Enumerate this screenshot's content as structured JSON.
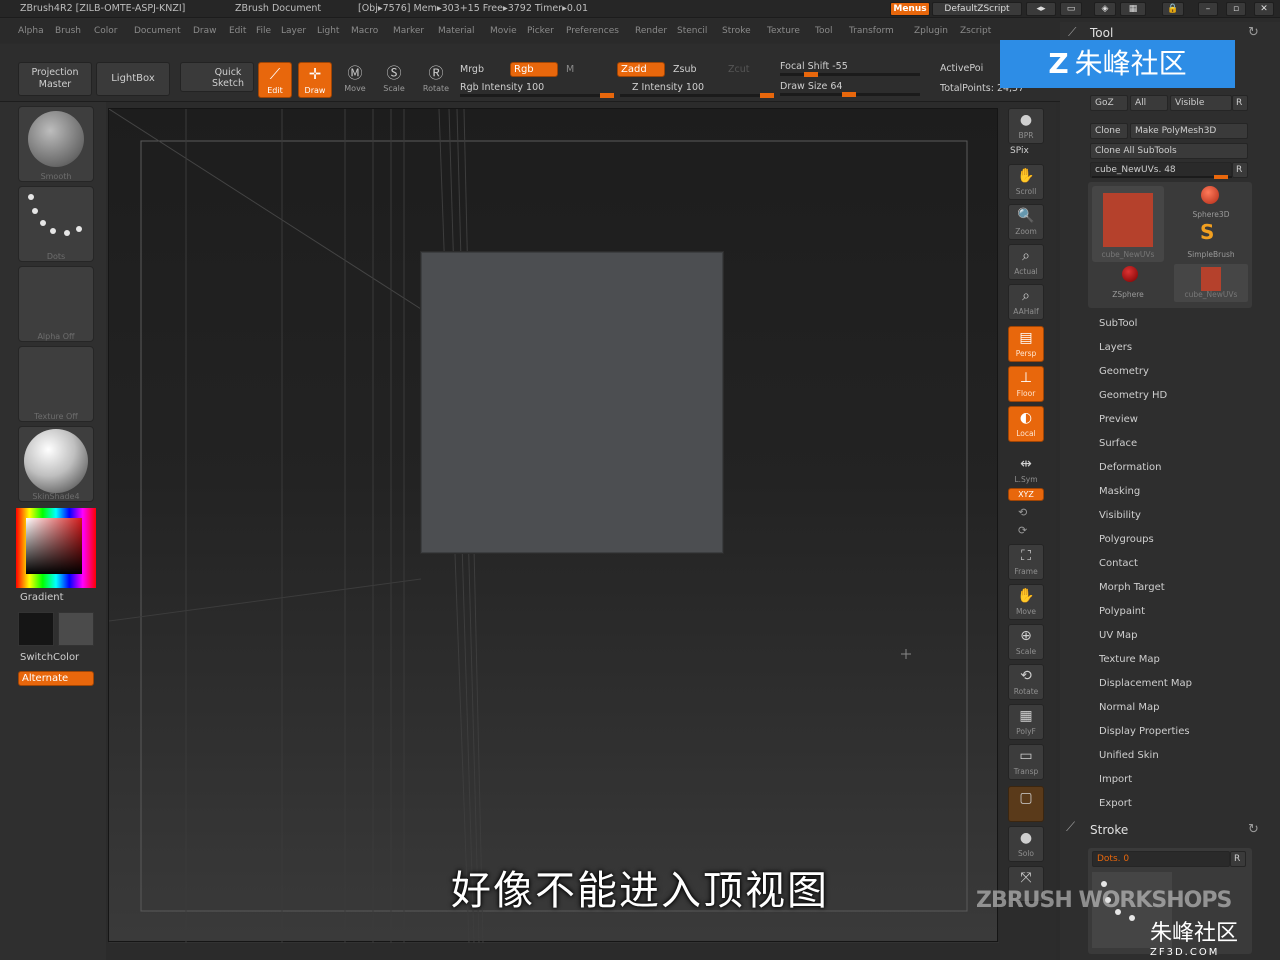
{
  "titlebar": {
    "app": "ZBrush4R2 [ZILB-OMTE-ASPJ-KNZI]",
    "document": "ZBrush Document",
    "stats": "[Obj▸7576] Mem▸303+15 Free▸3792 Timer▸0.01",
    "menus": "Menus",
    "script": "DefaultZScript"
  },
  "menubar": [
    "Alpha",
    "Brush",
    "Color",
    "Document",
    "Draw",
    "Edit",
    "File",
    "Layer",
    "Light",
    "Macro",
    "Marker",
    "Material",
    "Movie",
    "Picker",
    "Preferences",
    "Render",
    "Stencil",
    "Stroke",
    "Texture",
    "Tool",
    "Transform",
    "Zplugin",
    "Zscript"
  ],
  "toolbar": {
    "projection_master": "Projection Master",
    "lightbox": "LightBox",
    "quick_sketch": "Quick Sketch",
    "edit": "Edit",
    "draw": "Draw",
    "move": "Move",
    "scale": "Scale",
    "rotate": "Rotate",
    "mrgb": "Mrgb",
    "rgb": "Rgb",
    "m": "M",
    "rgb_intensity": "Rgb Intensity 100",
    "zadd": "Zadd",
    "zsub": "Zsub",
    "zcut": "Zcut",
    "z_intensity": "Z Intensity 100",
    "focal_shift": "Focal Shift -55",
    "draw_size": "Draw Size 64",
    "active_points": "ActivePoi",
    "total_points": "TotalPoints: 24,57"
  },
  "leftpanel": {
    "brush_caption": "Smooth",
    "stroke_caption": "Dots",
    "alpha_caption": "Alpha Off",
    "texture_caption": "Texture Off",
    "material_caption": "SkinShade4",
    "gradient": "Gradient",
    "switchcolor": "SwitchColor",
    "alternate": "Alternate"
  },
  "rightshelf": [
    "BPR",
    "SPix",
    "Scroll",
    "Zoom",
    "Actual",
    "AAHalf",
    "Persp",
    "Floor",
    "Local",
    "L.Sym",
    "Frame",
    "Move",
    "Scale",
    "Rotate",
    "PolyF",
    "Transp",
    "Solo"
  ],
  "rightshelf_extra": {
    "xyz": "XYZ"
  },
  "toolpalette": {
    "title": "Tool",
    "goz": "GoZ",
    "all": "All",
    "visible": "Visible",
    "r": "R",
    "clone": "Clone",
    "make_polymesh": "Make PolyMesh3D",
    "clone_all": "Clone All SubTools",
    "current_tool": "cube_NewUVs. 48",
    "thumb_main": "cube_NewUVs",
    "thumb_sphere": "Sphere3D",
    "thumb_simplebrush": "SimpleBrush",
    "thumb_zsphere": "ZSphere",
    "thumb_cube": "cube_NewUVs",
    "items": [
      "SubTool",
      "Layers",
      "Geometry",
      "Geometry HD",
      "Preview",
      "Surface",
      "Deformation",
      "Masking",
      "Visibility",
      "Polygroups",
      "Contact",
      "Morph Target",
      "Polypaint",
      "UV Map",
      "Texture Map",
      "Displacement Map",
      "Normal Map",
      "Display Properties",
      "Unified Skin",
      "Import",
      "Export"
    ],
    "stroke_title": "Stroke",
    "dots": "Dots. 0"
  },
  "subtitle": "好像不能进入顶视图",
  "watermarks": {
    "top": "朱峰社区",
    "workshops": "ZBRUSH WORKSHOPS",
    "corner": "朱峰社区",
    "corner_url": "ZF3D.COM"
  },
  "colors": {
    "accent": "#e8670c",
    "panel": "#2e2e2e",
    "canvas": "#1f1f1f"
  }
}
